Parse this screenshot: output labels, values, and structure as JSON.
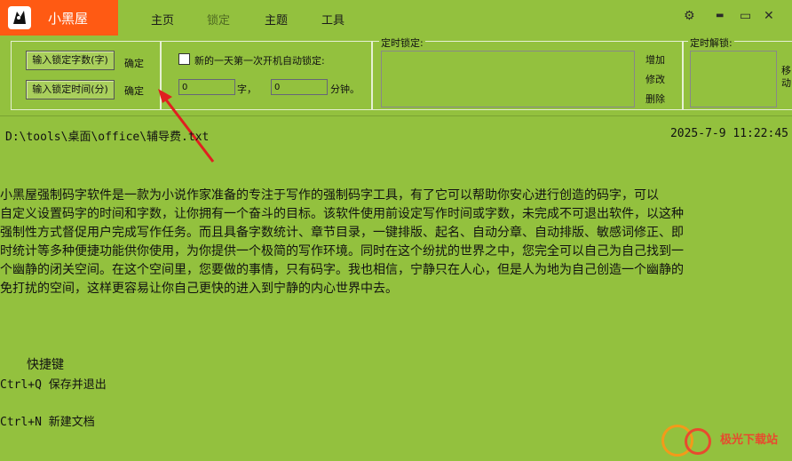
{
  "app": {
    "title": "小黑屋"
  },
  "menu": {
    "items": [
      "主页",
      "锁定",
      "主题",
      "工具"
    ]
  },
  "window_controls": {
    "settings": "⚙",
    "minimize": "▬",
    "maximize": "▭",
    "close": "✕"
  },
  "lock_settings": {
    "word_button": "输入锁定字数(字)",
    "time_button": "输入锁定时间(分)",
    "confirm1": "确定",
    "confirm2": "确定"
  },
  "auto_lock": {
    "checkbox_label": "新的一天第一次开机自动锁定:",
    "word_value": "0",
    "word_unit": "字，",
    "minute_value": "0",
    "minute_unit": "分钟。"
  },
  "timed_lock": {
    "title": "定时锁定:",
    "add": "增加",
    "edit": "修改",
    "delete": "删除"
  },
  "timed_unlock": {
    "title": "定时解锁:",
    "cut1": "移",
    "cut2": "动"
  },
  "document": {
    "path": "D:\\tools\\桌面\\office\\辅导费.txt",
    "datetime": "2025-7-9  11:22:45",
    "lines": [
      "    小黑屋强制码字软件是一款为小说作家准备的专注于写作的强制码字工具，有了它可以帮助你安心进行创造的码字，可以",
      "自定义设置码字的时间和字数，让你拥有一个奋斗的目标。该软件使用前设定写作时间或字数，未完成不可退出软件，以这种",
      "强制性方式督促用户完成写作任务。而且具备字数统计、章节目录，一键排版、起名、自动分章、自动排版、敏感词修正、即",
      "时统计等多种便捷功能供你使用，为你提供一个极简的写作环境。同时在这个纷扰的世界之中，您完全可以自己为自己找到一",
      "个幽静的闭关空间。在这个空间里，您要做的事情，只有码字。我也相信，宁静只在人心，但是人为地为自己创造一个幽静的",
      "免打扰的空间，这样更容易让你自己更快的进入到宁静的内心世界中去。"
    ],
    "shortcuts_heading": "快捷键",
    "shortcut1": "Ctrl+Q 保存并退出",
    "shortcut2": "Ctrl+N 新建文档"
  },
  "watermark": {
    "text": "极光下载站"
  }
}
